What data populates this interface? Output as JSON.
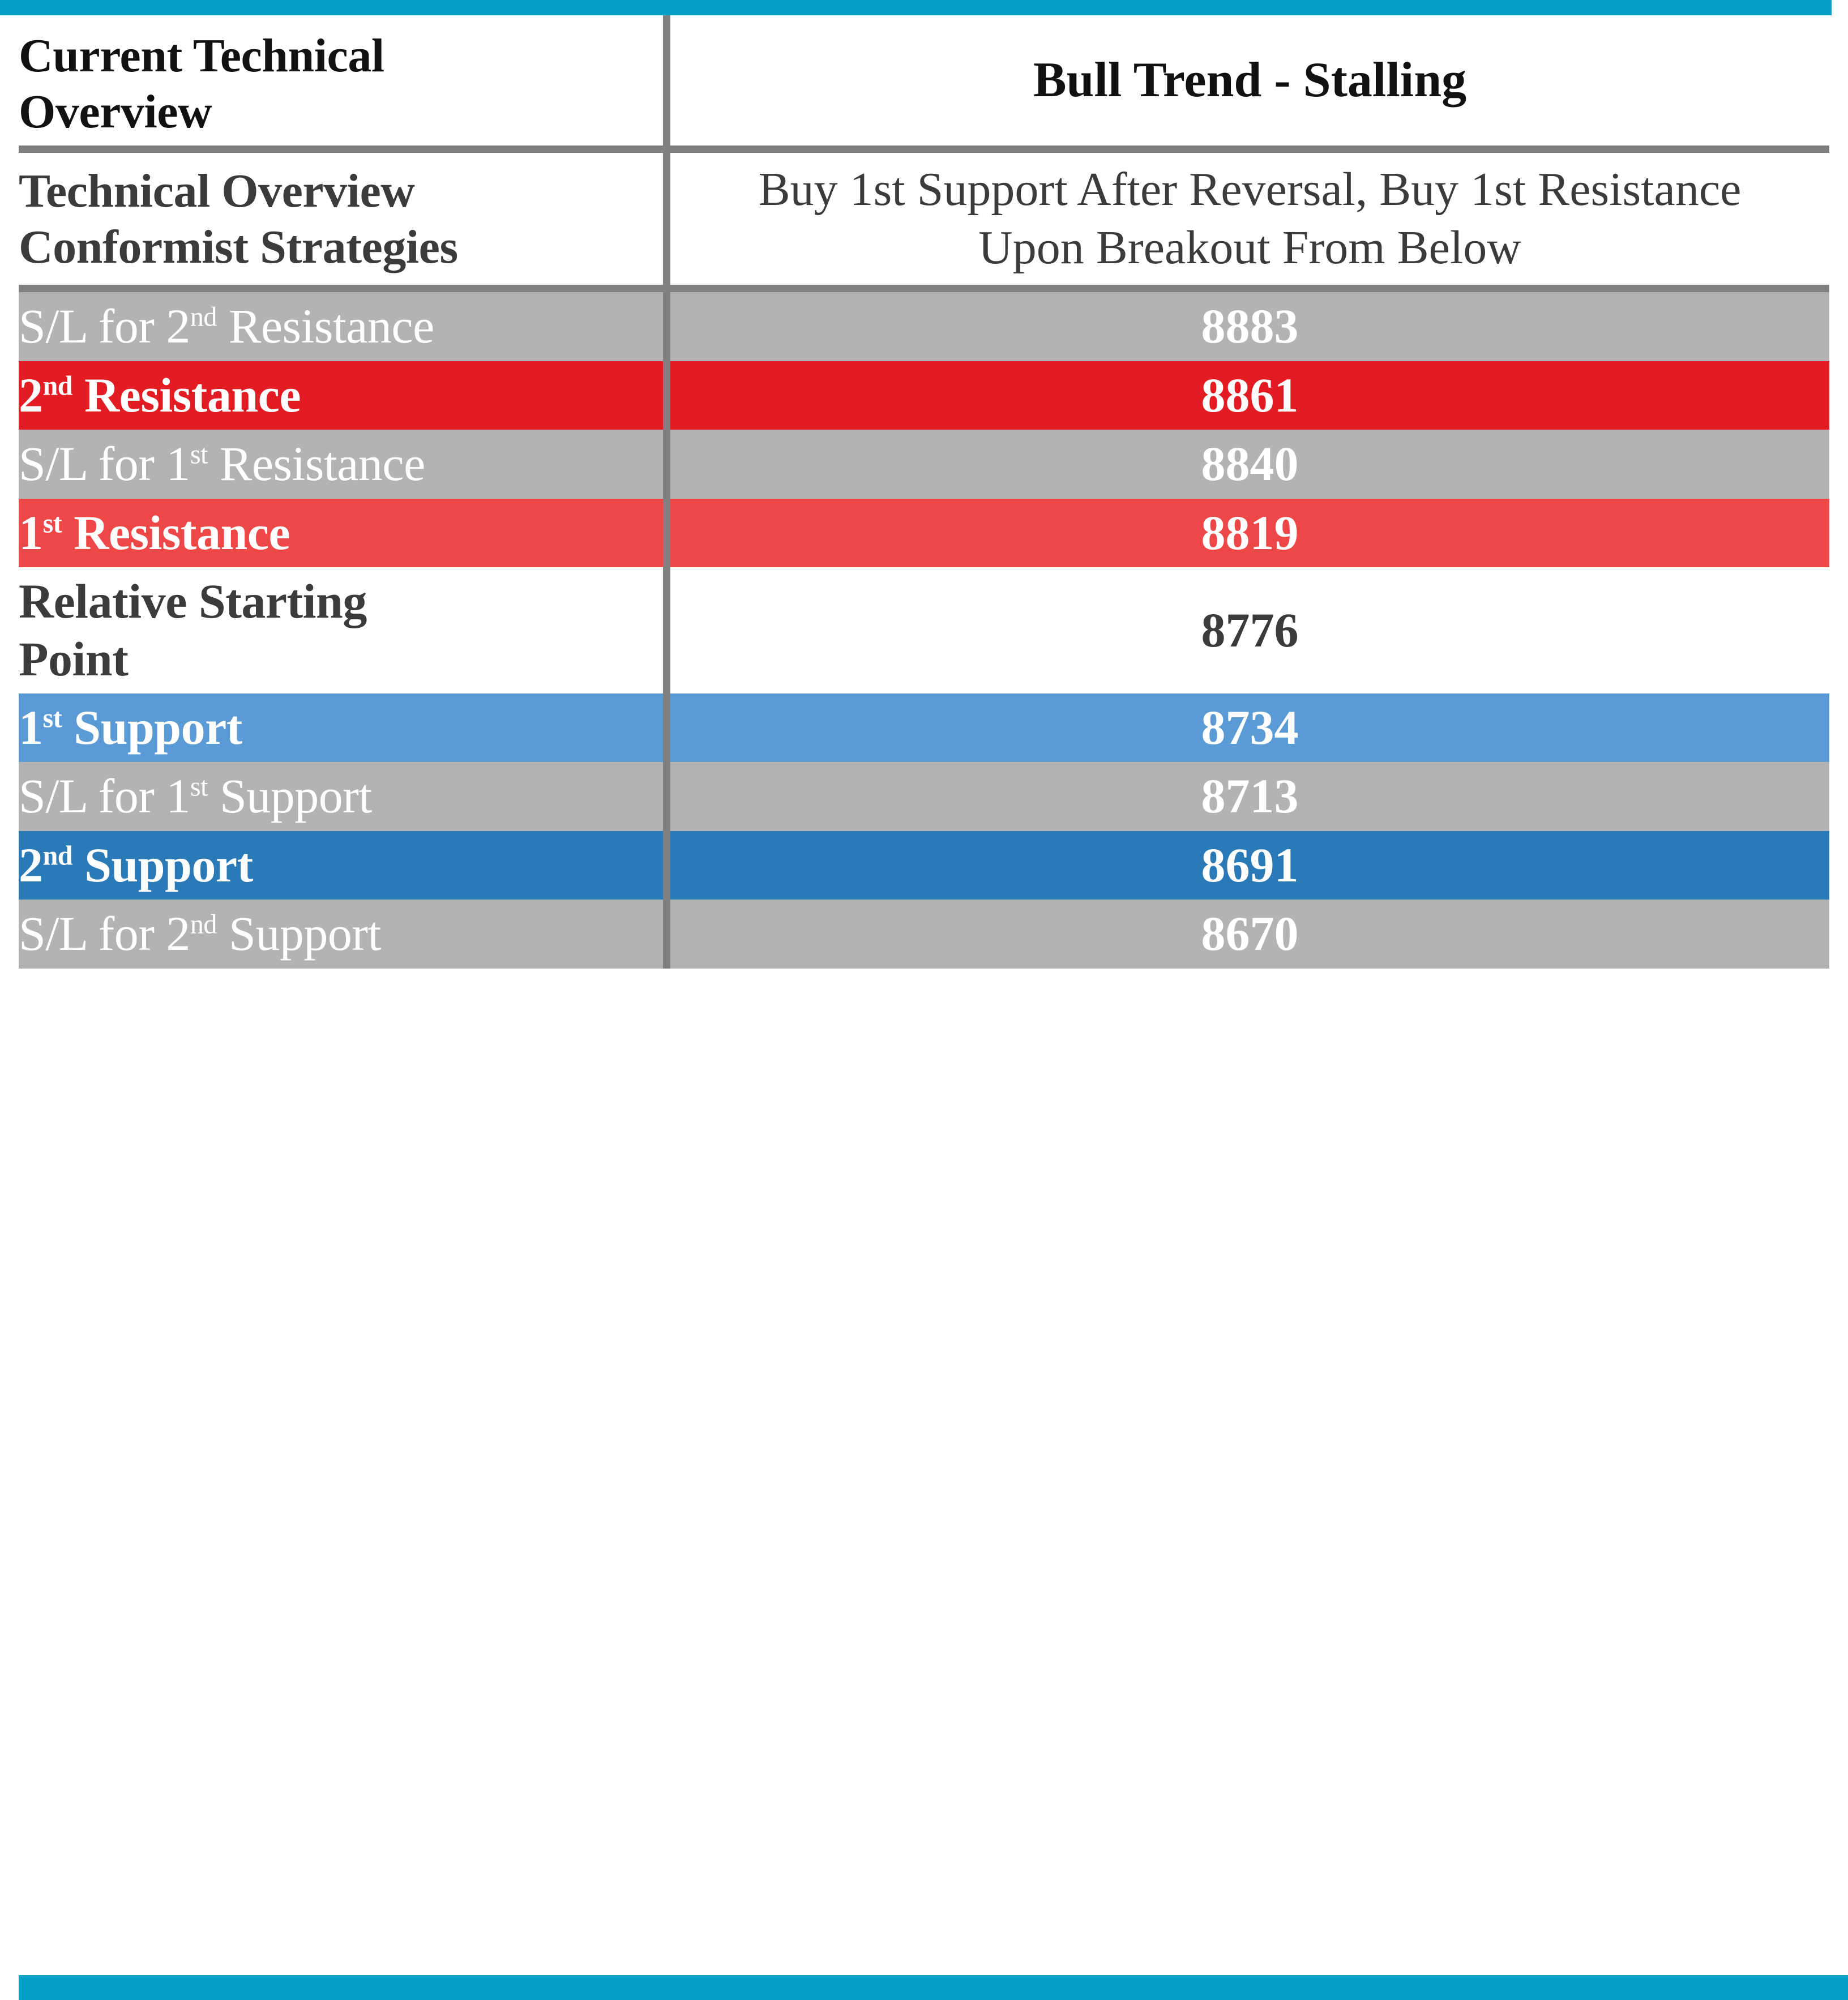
{
  "colors": {
    "accent_teal": "#039FC4",
    "divider_gray": "#808080",
    "row_gray": "#B3B3B3",
    "resistance_2nd_red": "#E31C23",
    "resistance_1st_red": "#EE4747",
    "support_1st_blue": "#5B9BD5",
    "support_2nd_blue": "#2B7AB8",
    "dark_text": "#3B3B3B",
    "white_text": "#FFFFFF"
  },
  "header": {
    "label": "Current Technical Overview",
    "label_line1": "Current Technical",
    "label_line2": "Overview",
    "value": "Bull Trend - Stalling"
  },
  "strategy_row": {
    "label": "Technical Overview Conformist Strategies",
    "label_line1": "Technical Overview",
    "label_line2": "Conformist Strategies",
    "value": "Buy 1st Support After Reversal, Buy 1st Resistance Upon Breakout From Below"
  },
  "levels": [
    {
      "id": "sl-2nd-resistance",
      "label_main": "S/L for 2",
      "label_sup": "nd",
      "label_tail": " Resistance",
      "label_plain": "S/L for 2nd Resistance",
      "value": "8883",
      "fill": "#B3B3B3",
      "text": "#FFFFFF",
      "weight": "normal"
    },
    {
      "id": "2nd-resistance",
      "label_main": "2",
      "label_sup": "nd",
      "label_tail": " Resistance",
      "label_plain": "2nd Resistance",
      "value": "8861",
      "fill": "#E31C23",
      "text": "#FFFFFF",
      "weight": "bold"
    },
    {
      "id": "sl-1st-resistance",
      "label_main": "S/L for 1",
      "label_sup": "st",
      "label_tail": " Resistance",
      "label_plain": "S/L for 1st Resistance",
      "value": "8840",
      "fill": "#B3B3B3",
      "text": "#FFFFFF",
      "weight": "normal"
    },
    {
      "id": "1st-resistance",
      "label_main": "1",
      "label_sup": "st",
      "label_tail": " Resistance",
      "label_plain": "1st Resistance",
      "value": "8819",
      "fill": "#EE4747",
      "text": "#FFFFFF",
      "weight": "bold"
    },
    {
      "id": "relative-starting-point",
      "label_main": "Relative Starting Point",
      "label_sup": "",
      "label_tail": "",
      "label_plain": "Relative Starting Point",
      "label_line1": "Relative Starting",
      "label_line2": "Point",
      "value": "8776",
      "fill": "#FFFFFF",
      "text": "#3B3B3B",
      "weight": "bold"
    },
    {
      "id": "1st-support",
      "label_main": "1",
      "label_sup": "st",
      "label_tail": " Support",
      "label_plain": "1st Support",
      "value": "8734",
      "fill": "#5B9BD5",
      "text": "#FFFFFF",
      "weight": "bold"
    },
    {
      "id": "sl-1st-support",
      "label_main": "S/L for 1",
      "label_sup": "st",
      "label_tail": " Support",
      "label_plain": "S/L for 1st Support",
      "value": "8713",
      "fill": "#B3B3B3",
      "text": "#FFFFFF",
      "weight": "normal"
    },
    {
      "id": "2nd-support",
      "label_main": "2",
      "label_sup": "nd",
      "label_tail": " Support",
      "label_plain": "2nd Support",
      "value": "8691",
      "fill": "#2B7AB8",
      "text": "#FFFFFF",
      "weight": "bold"
    },
    {
      "id": "sl-2nd-support",
      "label_main": "S/L for 2",
      "label_sup": "nd",
      "label_tail": " Support",
      "label_plain": "S/L for 2nd Support",
      "value": "8670",
      "fill": "#B3B3B3",
      "text": "#FFFFFF",
      "weight": "normal"
    }
  ]
}
